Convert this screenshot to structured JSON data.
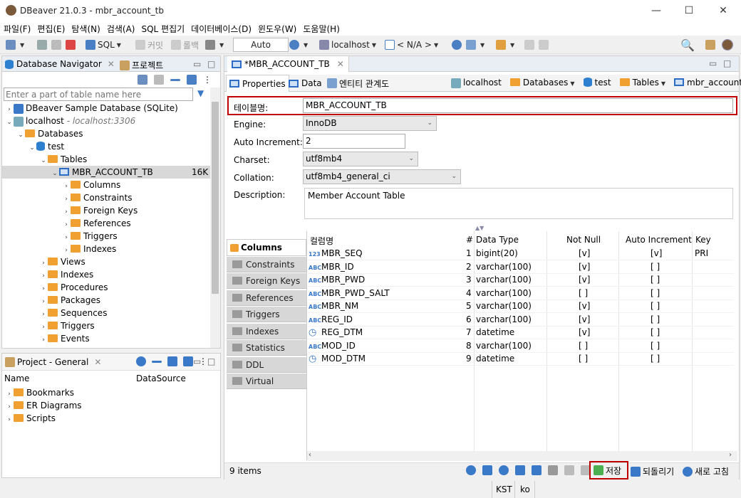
{
  "window": {
    "title": "DBeaver 21.0.3 - mbr_account_tb",
    "min": "—",
    "max": "☐",
    "close": "✕"
  },
  "menu": [
    "파일(F)",
    "편집(E)",
    "탐색(N)",
    "검색(A)",
    "SQL 편집기",
    "데이터베이스(D)",
    "윈도우(W)",
    "도움말(H)"
  ],
  "toolbar": {
    "sql": "SQL",
    "commit": "커밋",
    "rollback": "롤백",
    "mode": "Auto",
    "connection": "localhost",
    "schema": "< N/A >"
  },
  "left": {
    "nav_tab": "Database Navigator",
    "proj_tab": "프로젝트",
    "filter_placeholder": "Enter a part of table name here",
    "tree": [
      {
        "label": "DBeaver Sample Database (SQLite)"
      },
      {
        "label": "localhost",
        "sub": " - localhost:3306"
      },
      {
        "label": "Databases"
      },
      {
        "label": "test"
      },
      {
        "label": "Tables"
      },
      {
        "label": "MBR_ACCOUNT_TB",
        "size": "16K"
      },
      {
        "label": "Columns"
      },
      {
        "label": "Constraints"
      },
      {
        "label": "Foreign Keys"
      },
      {
        "label": "References"
      },
      {
        "label": "Triggers"
      },
      {
        "label": "Indexes"
      },
      {
        "label": "Views"
      },
      {
        "label": "Indexes"
      },
      {
        "label": "Procedures"
      },
      {
        "label": "Packages"
      },
      {
        "label": "Sequences"
      },
      {
        "label": "Triggers"
      },
      {
        "label": "Events"
      }
    ]
  },
  "project": {
    "tab": "Project - General",
    "col_name": "Name",
    "col_ds": "DataSource",
    "items": [
      "Bookmarks",
      "ER Diagrams",
      "Scripts"
    ]
  },
  "editor": {
    "tab": "*MBR_ACCOUNT_TB",
    "subtabs": [
      "Properties",
      "Data",
      "엔티티 관계도"
    ],
    "crumbs": [
      "localhost",
      "Databases",
      "test",
      "Tables",
      "mbr_account_tb"
    ],
    "table_name_label": "테이블명:",
    "table_name": "MBR_ACCOUNT_TB",
    "engine_label": "Engine:",
    "engine": "InnoDB",
    "autoinc_label": "Auto Increment:",
    "autoinc": "2",
    "charset_label": "Charset:",
    "charset": "utf8mb4",
    "collation_label": "Collation:",
    "collation": "utf8mb4_general_ci",
    "desc_label": "Description:",
    "desc": "Member Account Table"
  },
  "sidetabs": [
    "Columns",
    "Constraints",
    "Foreign Keys",
    "References",
    "Triggers",
    "Indexes",
    "Statistics",
    "DDL",
    "Virtual"
  ],
  "columns": {
    "headers": [
      "컬럼명",
      "#",
      "Data Type",
      "Not Null",
      "Auto Increment",
      "Key"
    ],
    "rows": [
      [
        "MBR_SEQ",
        "1",
        "bigint(20)",
        "[v]",
        "[v]",
        "PRI"
      ],
      [
        "MBR_ID",
        "2",
        "varchar(100)",
        "[v]",
        "[ ]",
        ""
      ],
      [
        "MBR_PWD",
        "3",
        "varchar(100)",
        "[v]",
        "[ ]",
        ""
      ],
      [
        "MBR_PWD_SALT",
        "4",
        "varchar(100)",
        "[ ]",
        "[ ]",
        ""
      ],
      [
        "MBR_NM",
        "5",
        "varchar(100)",
        "[v]",
        "[ ]",
        ""
      ],
      [
        "REG_ID",
        "6",
        "varchar(100)",
        "[v]",
        "[ ]",
        ""
      ],
      [
        "REG_DTM",
        "7",
        "datetime",
        "[v]",
        "[ ]",
        ""
      ],
      [
        "MOD_ID",
        "8",
        "varchar(100)",
        "[ ]",
        "[ ]",
        ""
      ],
      [
        "MOD_DTM",
        "9",
        "datetime",
        "[ ]",
        "[ ]",
        ""
      ]
    ]
  },
  "status": {
    "items": "9 items",
    "save": "저장",
    "revert": "되돌리기",
    "refresh": "새로 고침",
    "tz": "KST",
    "lang": "ko"
  }
}
